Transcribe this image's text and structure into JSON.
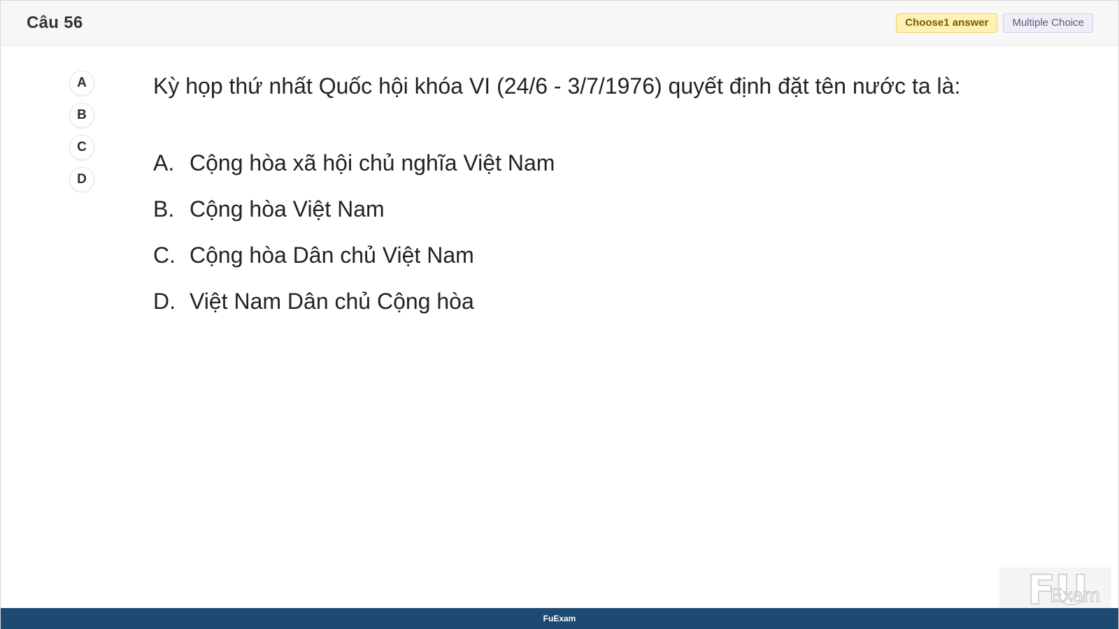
{
  "header": {
    "question_number": "Câu 56",
    "badge_choose": "Choose1 answer",
    "badge_type": "Multiple Choice"
  },
  "selectors": [
    {
      "label": "A"
    },
    {
      "label": "B"
    },
    {
      "label": "C"
    },
    {
      "label": "D"
    }
  ],
  "question": {
    "text": "Kỳ họp thứ nhất Quốc hội khóa VI (24/6 - 3/7/1976) quyết định đặt tên nước ta là:"
  },
  "options": [
    {
      "letter": "A.",
      "text": "Cộng hòa xã hội chủ nghĩa Việt Nam"
    },
    {
      "letter": "B.",
      "text": "Cộng hòa Việt Nam"
    },
    {
      "letter": "C.",
      "text": "Cộng hòa Dân chủ Việt Nam"
    },
    {
      "letter": "D.",
      "text": "Việt Nam Dân chủ Cộng hòa"
    }
  ],
  "logo": {
    "mark": "FU",
    "word": "Exam"
  },
  "footer": {
    "text": "FuExam"
  },
  "colors": {
    "header_bg": "#f7f7f7",
    "badge_choose_bg": "#fdf1b5",
    "badge_type_bg": "#eeeef9",
    "footer_bg": "#1d4a73"
  }
}
